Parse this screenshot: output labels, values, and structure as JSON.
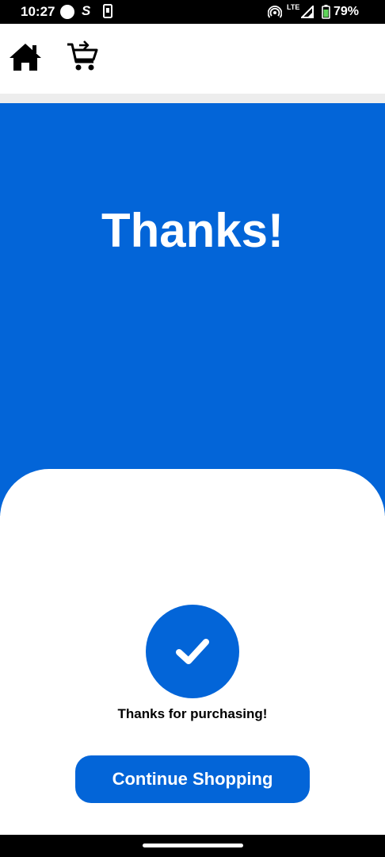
{
  "status_bar": {
    "time": "10:27",
    "network": "LTE",
    "battery": "79%"
  },
  "app_bar": {
    "icons": [
      "home-icon",
      "cart-checkout-icon"
    ]
  },
  "hero": {
    "title": "Thanks!"
  },
  "confirmation": {
    "message": "Thanks for purchasing!",
    "icon": "checkmark-icon",
    "button_label": "Continue Shopping"
  },
  "colors": {
    "accent": "#0365d8",
    "background": "#ffffff",
    "divider": "#ededed"
  }
}
